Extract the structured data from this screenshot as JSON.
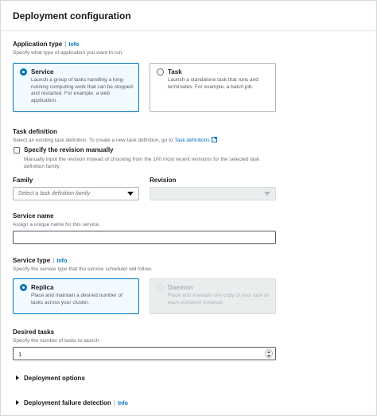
{
  "panel": {
    "title": "Deployment configuration"
  },
  "app_type": {
    "label": "Application type",
    "info": "Info",
    "description": "Specify what type of application you want to run.",
    "options": [
      {
        "title": "Service",
        "description": "Launch a group of tasks handling a long-running computing work that can be stopped and restarted. For example, a web application.",
        "selected": true
      },
      {
        "title": "Task",
        "description": "Launch a standalone task that runs and terminates. For example, a batch job.",
        "selected": false
      }
    ]
  },
  "task_definition": {
    "label": "Task definition",
    "description_prefix": "Select an existing task definition. To create a new task definition, go to",
    "link": "Task definitions",
    "checkbox_label": "Specify the revision manually",
    "checkbox_description": "Manually input the revision instead of choosing from the 100 most recent revisions for the selected task definition family.",
    "family_label": "Family",
    "family_placeholder": "Select a task definition family",
    "revision_label": "Revision"
  },
  "service_name": {
    "label": "Service name",
    "description": "Assign a unique name for this service.",
    "value": ""
  },
  "service_type": {
    "label": "Service type",
    "info": "Info",
    "description": "Specify the service type that the service scheduler will follow.",
    "options": [
      {
        "title": "Replica",
        "description": "Place and maintain a desired number of tasks across your cluster.",
        "selected": true
      },
      {
        "title": "Daemon",
        "description": "Place and maintain one copy of your task on each container instance.",
        "selected": false,
        "disabled": true
      }
    ]
  },
  "desired_tasks": {
    "label": "Desired tasks",
    "description": "Specify the number of tasks to launch.",
    "value": "1"
  },
  "sections": {
    "deployment_options": "Deployment options",
    "failure_detection": "Deployment failure detection",
    "failure_detection_info": "Info"
  },
  "colors": {
    "accent": "#0073bb",
    "selected_bg": "#f1faff",
    "text": "#16191f",
    "muted": "#687078"
  }
}
